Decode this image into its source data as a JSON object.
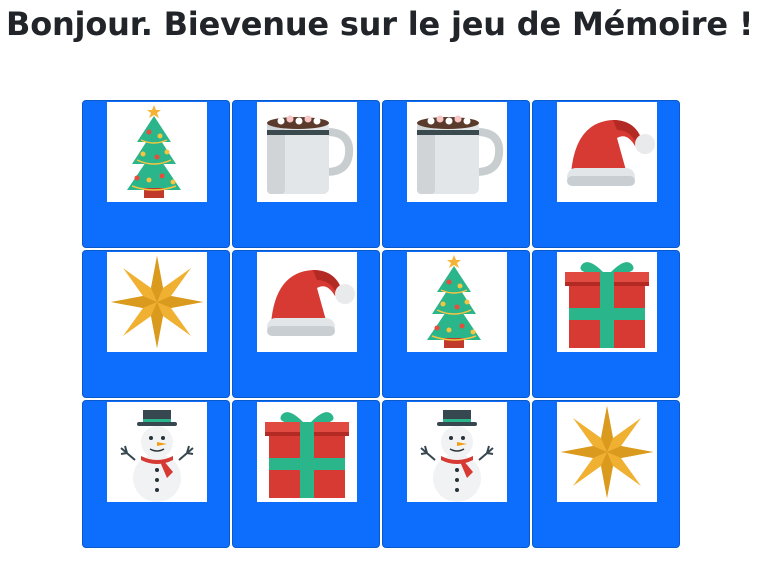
{
  "header": {
    "title": "Bonjour. Bievenue sur le jeu de Mémoire !"
  },
  "board": {
    "columns": 4,
    "rows": 3,
    "card_color": "#0d6efd",
    "cards": [
      {
        "icon": "christmas-tree-icon"
      },
      {
        "icon": "hot-cocoa-mug-icon"
      },
      {
        "icon": "hot-cocoa-mug-icon"
      },
      {
        "icon": "santa-hat-icon"
      },
      {
        "icon": "gold-star-icon"
      },
      {
        "icon": "santa-hat-icon"
      },
      {
        "icon": "christmas-tree-icon"
      },
      {
        "icon": "gift-box-icon"
      },
      {
        "icon": "snowman-icon"
      },
      {
        "icon": "gift-box-icon"
      },
      {
        "icon": "snowman-icon"
      },
      {
        "icon": "gold-star-icon"
      }
    ]
  }
}
